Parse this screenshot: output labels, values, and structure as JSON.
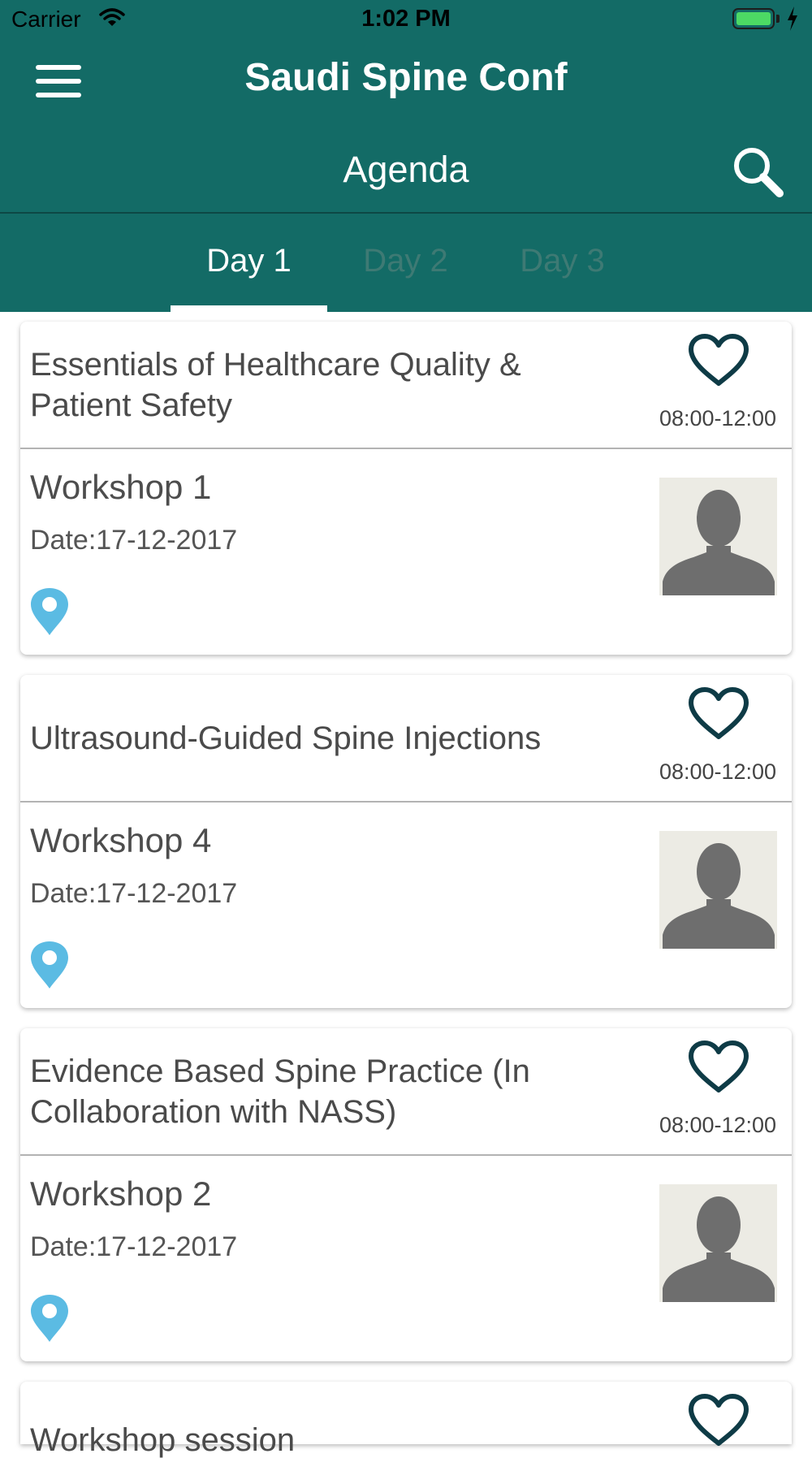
{
  "status_bar": {
    "carrier": "Carrier",
    "time": "1:02 PM",
    "battery_color": "#4cd964"
  },
  "header": {
    "app_title": "Saudi Spine Conf",
    "page_title": "Agenda",
    "menu_icon": "hamburger-menu-icon",
    "search_icon": "search-icon",
    "background_color": "#136b66"
  },
  "tabs": [
    {
      "label": "Day 1",
      "selected": true
    },
    {
      "label": "Day 2",
      "selected": false
    },
    {
      "label": "Day 3",
      "selected": false
    }
  ],
  "sessions": [
    {
      "title": "Essentials of Healthcare Quality & Patient Safety",
      "time": "08:00-12:00",
      "workshop": "Workshop 1",
      "date": "Date:17-12-2017"
    },
    {
      "title": "Ultrasound-Guided Spine Injections",
      "time": "08:00-12:00",
      "workshop": "Workshop 4",
      "date": "Date:17-12-2017"
    },
    {
      "title": "Evidence Based Spine Practice (In Collaboration with NASS)",
      "time": "08:00-12:00",
      "workshop": "Workshop 2",
      "date": "Date:17-12-2017"
    },
    {
      "title": "Workshop session"
    }
  ],
  "icons": {
    "favorite": "heart-outline-icon",
    "location": "location-pin-icon",
    "speaker": "avatar-placeholder"
  },
  "colors": {
    "heart": "#0e3b46",
    "pin": "#5bbbe3",
    "tab_inactive": "#3e7a74"
  }
}
